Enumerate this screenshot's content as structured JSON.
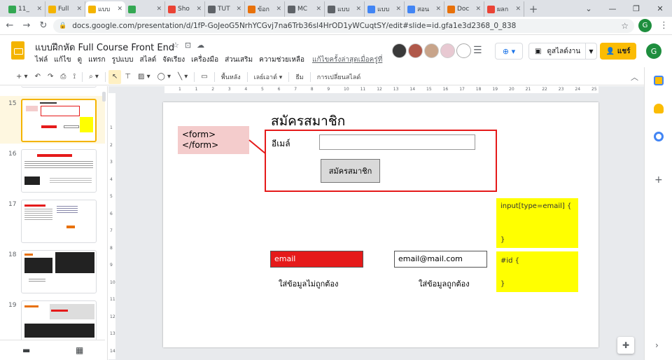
{
  "browser": {
    "tabs": [
      {
        "label": "11_",
        "color": "#34a853"
      },
      {
        "label": "Full",
        "color": "#f4b400"
      },
      {
        "label": "แบบ",
        "color": "#f4b400",
        "active": true
      },
      {
        "label": "",
        "color": "#34a853"
      },
      {
        "label": "Sho",
        "color": "#ea4335"
      },
      {
        "label": "TUT",
        "color": "#5f6368"
      },
      {
        "label": "ข้อก",
        "color": "#e8710a"
      },
      {
        "label": "MC",
        "color": "#5f6368"
      },
      {
        "label": "แบบ",
        "color": "#5f6368"
      },
      {
        "label": "แบบ",
        "color": "#4285f4"
      },
      {
        "label": "สอน",
        "color": "#4285f4"
      },
      {
        "label": "Doc",
        "color": "#e8710a"
      },
      {
        "label": "ผลก",
        "color": "#ea4335"
      }
    ],
    "new_tab": "+",
    "url": "docs.google.com/presentation/d/1fP-GoJeoG5NrhYCGvj7na6Trb36sl4HrOD1yWCuqtSY/edit#slide=id.gfa1e3d2368_0_838",
    "profile_initial": "G"
  },
  "docs": {
    "title": "แบบฝึกหัด Full Course Front End",
    "menu": [
      "ไฟล์",
      "แก้ไข",
      "ดู",
      "แทรก",
      "รูปแบบ",
      "สไลด์",
      "จัดเรียง",
      "เครื่องมือ",
      "ส่วนเสริม",
      "ความช่วยเหลือ"
    ],
    "last_edit": "แก้ไขครั้งล่าสุดเมื่อครู่ที่",
    "slideshow_label": "ดูสไลด์งาน",
    "share_label": "แชร์",
    "account_initial": "G",
    "accent": "#fbbc04"
  },
  "toolbar": {
    "background_label": "พื้นหลัง",
    "layout_label": "เลย์เอาต์",
    "theme_label": "ธีม",
    "transition_label": "การเปลี่ยนสไลด์"
  },
  "filmstrip": {
    "slides": [
      {
        "num": "15",
        "active": true
      },
      {
        "num": "16"
      },
      {
        "num": "17"
      },
      {
        "num": "18"
      },
      {
        "num": "19"
      }
    ]
  },
  "ruler": {
    "h": [
      "1",
      "1",
      "2",
      "3",
      "4",
      "5",
      "6",
      "7",
      "8",
      "9",
      "10",
      "11",
      "12",
      "13",
      "14",
      "15",
      "16",
      "17",
      "18",
      "19",
      "20",
      "21",
      "22",
      "23",
      "24",
      "25"
    ],
    "v": [
      "1",
      "2",
      "3",
      "4",
      "5",
      "6",
      "7",
      "8",
      "9",
      "10",
      "11",
      "12",
      "13",
      "14"
    ]
  },
  "slide": {
    "title": "สมัครสมาชิก",
    "form_tag": "<form>\n</form>",
    "email_label": "อีเมล์",
    "submit_label": "สมัครสมาชิก",
    "css_email_open": "input[type=email] {",
    "css_email_close": "}",
    "css_id_open": "#id {",
    "css_id_close": "}",
    "invalid_value": "email",
    "valid_value": "email@mail.com",
    "invalid_caption": "ใส่ข้อมูลไม่ถูกต้อง",
    "valid_caption": "ใส่ข้อมูลถูกต้อง",
    "colors": {
      "red": "#e51a1a",
      "pink": "#f4cccc",
      "yellow": "#ffff00",
      "gray": "#d9d9d9"
    }
  }
}
